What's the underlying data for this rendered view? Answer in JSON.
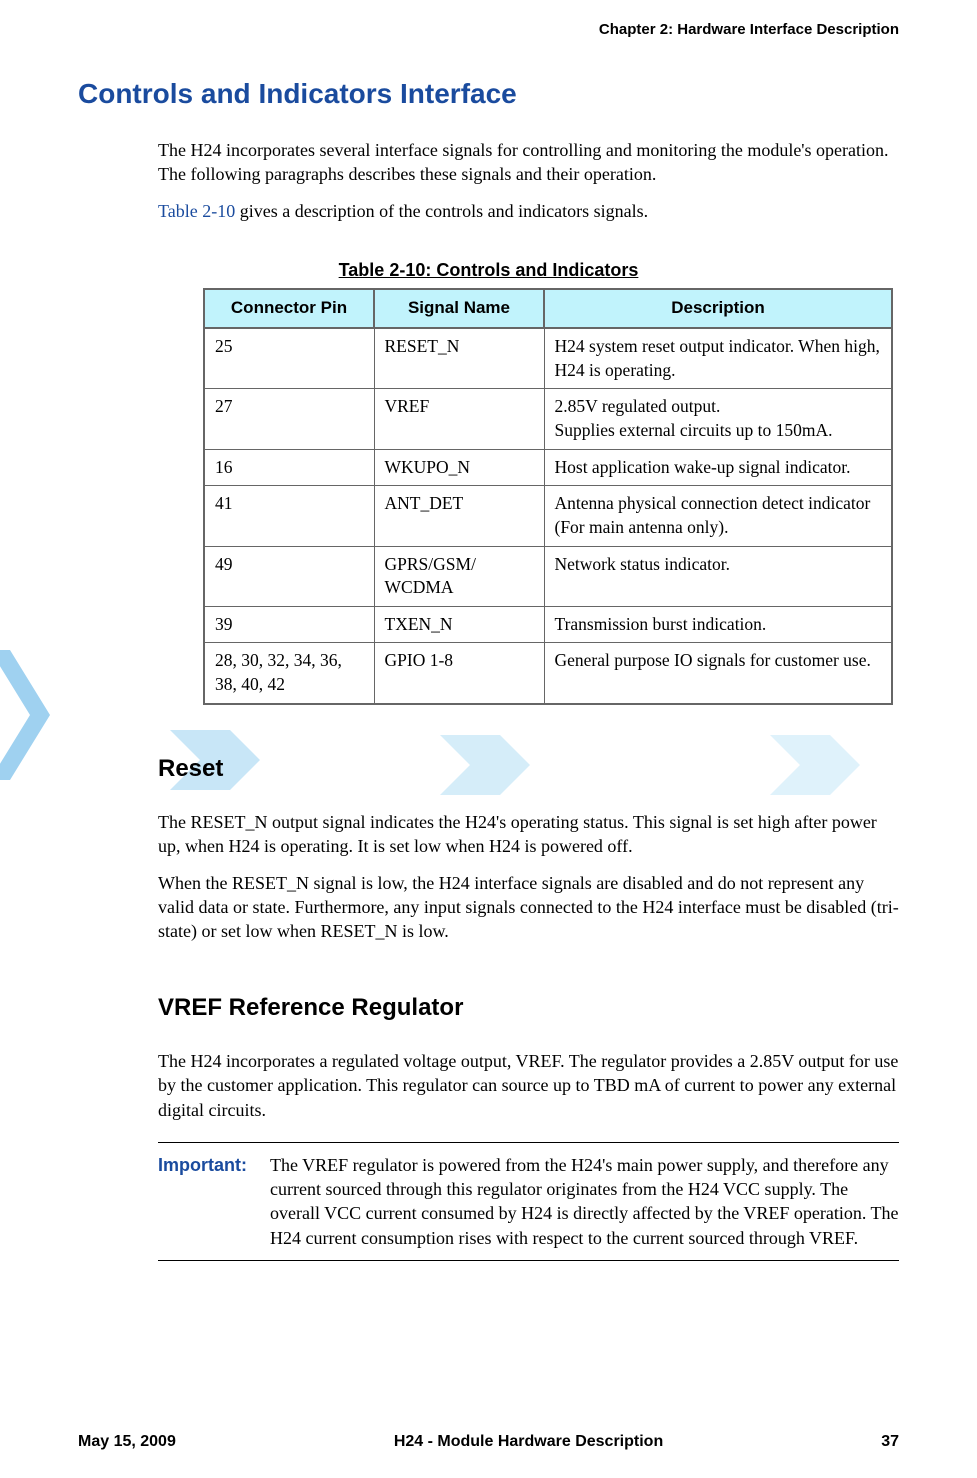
{
  "header": {
    "chapter": "Chapter 2:  Hardware Interface Description"
  },
  "section": {
    "title": "Controls and Indicators Interface",
    "intro_p1": "The H24 incorporates several interface signals for controlling and monitoring the module's operation. The following paragraphs describes these signals and their operation.",
    "intro_p2_link": "Table 2-10",
    "intro_p2_rest": " gives a description of the controls and indicators signals."
  },
  "table": {
    "caption": "Table 2-10: Controls and Indicators",
    "headers": {
      "pin": "Connector Pin",
      "signal": "Signal Name",
      "desc": "Description"
    },
    "rows": [
      {
        "pin": "25",
        "signal": "RESET_N",
        "desc": "H24 system reset output indicator. When high, H24 is operating."
      },
      {
        "pin": "27",
        "signal": "VREF",
        "desc": "2.85V regulated output.\nSupplies external circuits up to 150mA."
      },
      {
        "pin": "16",
        "signal": "WKUPO_N",
        "desc": "Host application wake-up signal indicator."
      },
      {
        "pin": "41",
        "signal": "ANT_DET",
        "desc": "Antenna physical connection detect indicator (For main antenna only)."
      },
      {
        "pin": "49",
        "signal": "GPRS/GSM/\nWCDMA",
        "desc": "Network status indicator."
      },
      {
        "pin": "39",
        "signal": "TXEN_N",
        "desc": "Transmission burst indication."
      },
      {
        "pin": "28, 30, 32, 34, 36, 38, 40, 42",
        "signal": "GPIO 1-8",
        "desc": "General purpose IO signals for customer use."
      }
    ]
  },
  "reset": {
    "title": "Reset",
    "p1": "The RESET_N output signal indicates the H24's operating status. This signal is set high after power up, when H24 is operating. It is set low when H24 is powered off.",
    "p2": "When the RESET_N signal is low, the H24 interface signals are disabled and do not represent any valid data or state. Furthermore, any input signals connected to the H24 interface must be disabled (tri-state) or set low when RESET_N is low."
  },
  "vref": {
    "title": "VREF Reference Regulator",
    "p1": "The H24 incorporates a regulated voltage output, VREF. The regulator provides a 2.85V output for use by the customer application. This regulator can source up to TBD mA of current to power any external digital circuits.",
    "important_label": "Important:",
    "important_text": "The VREF regulator is powered from the H24's main power supply, and therefore any current sourced through this regulator originates from the H24 VCC supply. The overall VCC current consumed by H24 is directly affected by the VREF operation. The H24 current consumption rises with respect to the current sourced through VREF."
  },
  "footer": {
    "date": "May 15, 2009",
    "title": "H24 - Module Hardware Description",
    "page": "37"
  }
}
